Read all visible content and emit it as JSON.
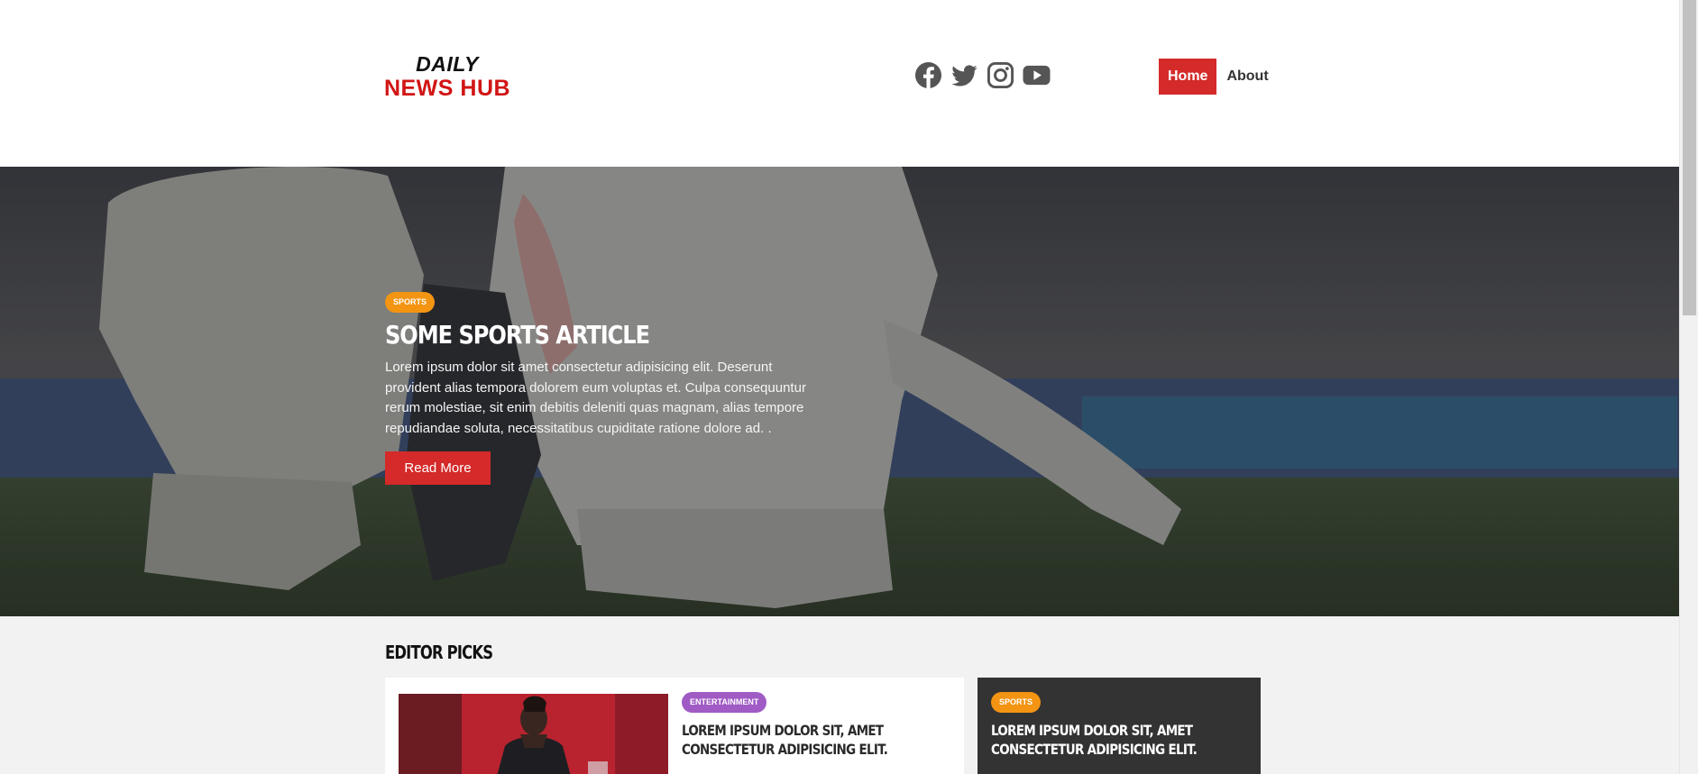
{
  "header": {
    "logo_line1": "DAILY",
    "logo_line2": "NEWS HUB",
    "socials": [
      {
        "name": "facebook-icon"
      },
      {
        "name": "twitter-icon"
      },
      {
        "name": "instagram-icon"
      },
      {
        "name": "youtube-icon"
      }
    ],
    "nav": [
      {
        "label": "Home",
        "active": true
      },
      {
        "label": "About",
        "active": false
      }
    ]
  },
  "hero": {
    "category": "SPORTS",
    "title": "Some Sports Article",
    "text": "Lorem ipsum dolor sit amet consectetur adipisicing elit. Deserunt provident alias tempora dolorem eum voluptas et. Culpa consequuntur rerum molestiae, sit enim debitis deleniti quas magnam, alias tempore repudiandae soluta, necessitatibus cupiditate ratione dolore ad. .",
    "button_label": "Read More"
  },
  "editor_picks": {
    "title": "Editor Picks",
    "cards": [
      {
        "category": "ENTERTAINMENT",
        "title": "Lorem ipsum dolor sit, amet consectetur adipisicing elit."
      },
      {
        "category": "SPORTS",
        "title": "Lorem ipsum dolor sit, amet consectetur adipisicing elit."
      }
    ]
  },
  "colors": {
    "brand_red": "#d42a2a",
    "sports_badge": "#f39412",
    "entertainment_badge": "#a05bc4",
    "dark_card": "#333333"
  }
}
